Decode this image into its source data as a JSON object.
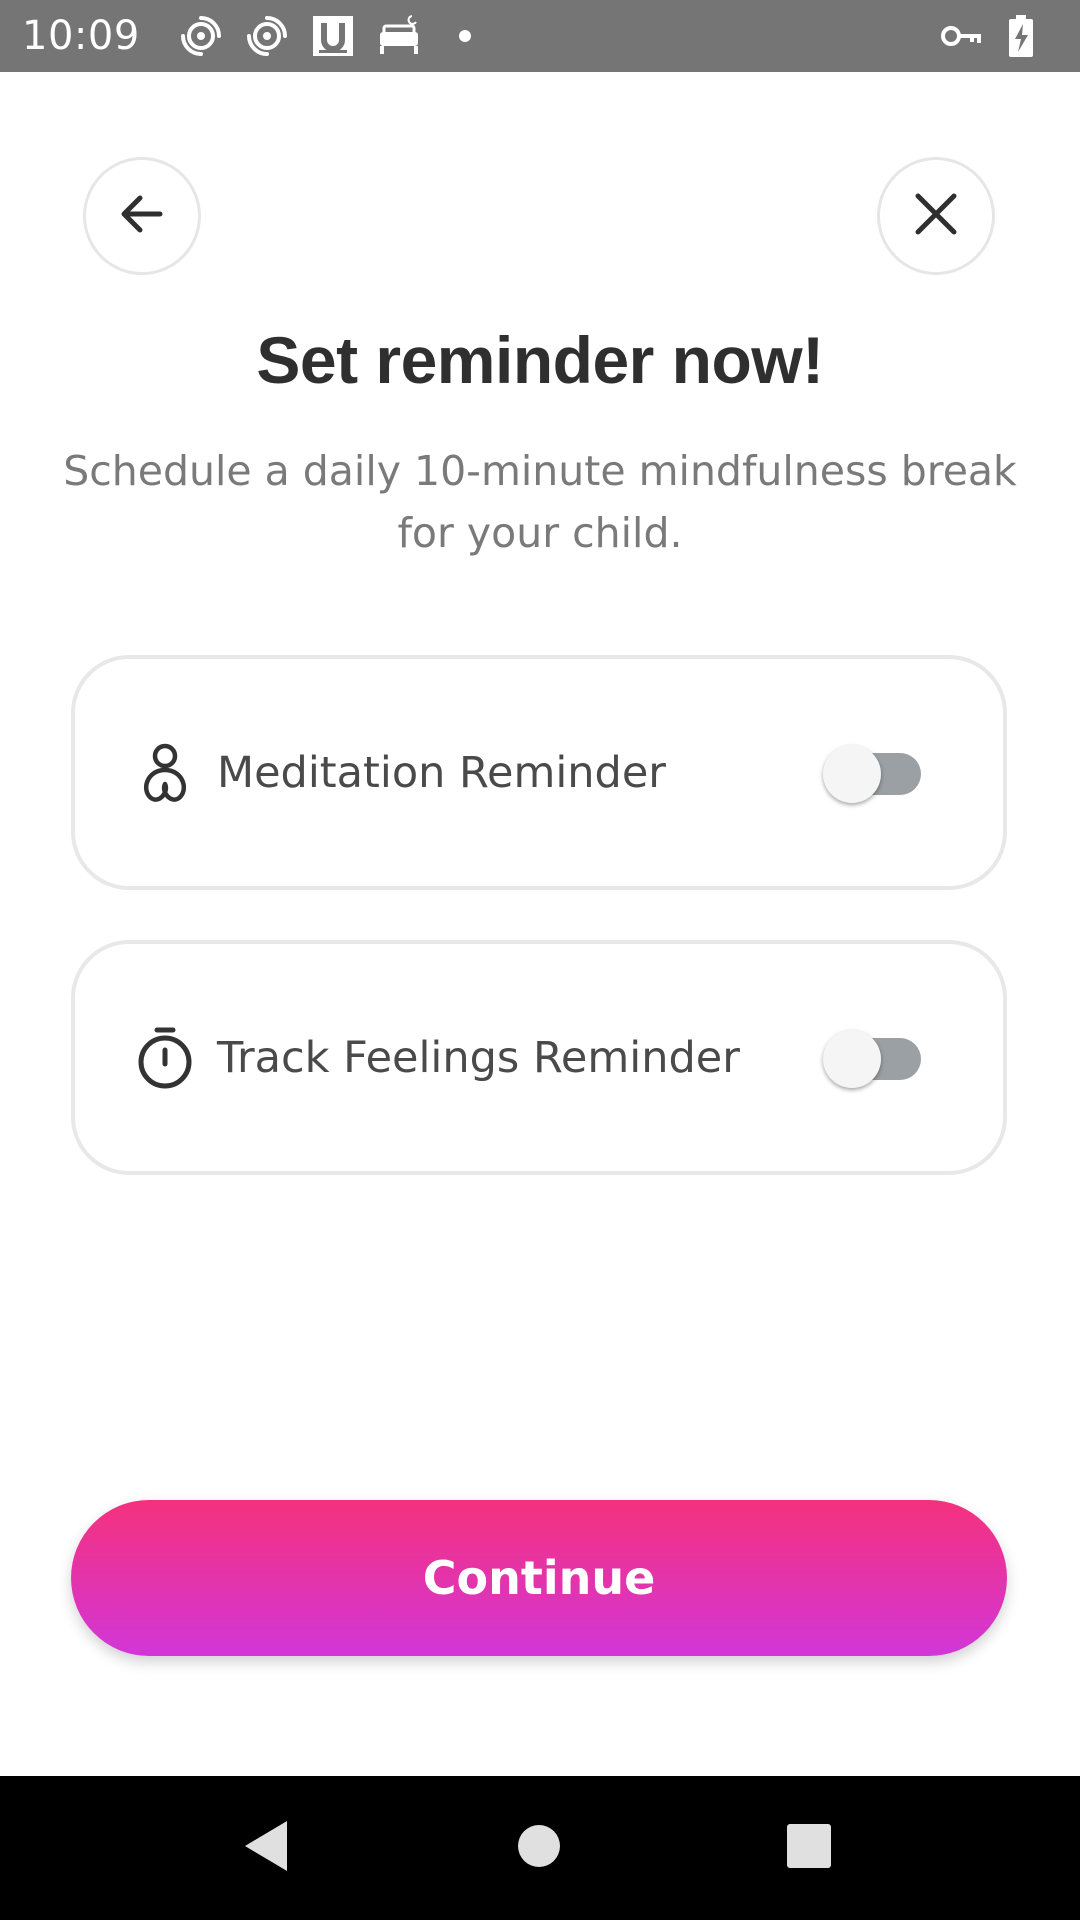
{
  "status_bar": {
    "time": "10:09",
    "left_icons": [
      "spiral-icon",
      "spiral-icon",
      "u-box-icon",
      "bed-icon",
      "dot-icon"
    ],
    "right_icons": [
      "vpn-key-icon",
      "battery-charging-icon"
    ]
  },
  "header": {
    "back_icon": "arrow-left-icon",
    "close_icon": "close-icon"
  },
  "title": "Set reminder now!",
  "subtitle": "Schedule a daily 10-minute mindfulness break for your child.",
  "reminders": [
    {
      "label": "Meditation Reminder",
      "icon": "meditation-icon",
      "enabled": false
    },
    {
      "label": "Track Feelings Reminder",
      "icon": "stopwatch-icon",
      "enabled": false
    }
  ],
  "continue_label": "Continue",
  "colors": {
    "gradient_start": "#f5317d",
    "gradient_end": "#d236d8",
    "status_bar": "#757575",
    "toggle_off_track": "#9aa0a4"
  },
  "nav_bar": {
    "icons": [
      "nav-back-icon",
      "nav-home-icon",
      "nav-recents-icon"
    ]
  }
}
